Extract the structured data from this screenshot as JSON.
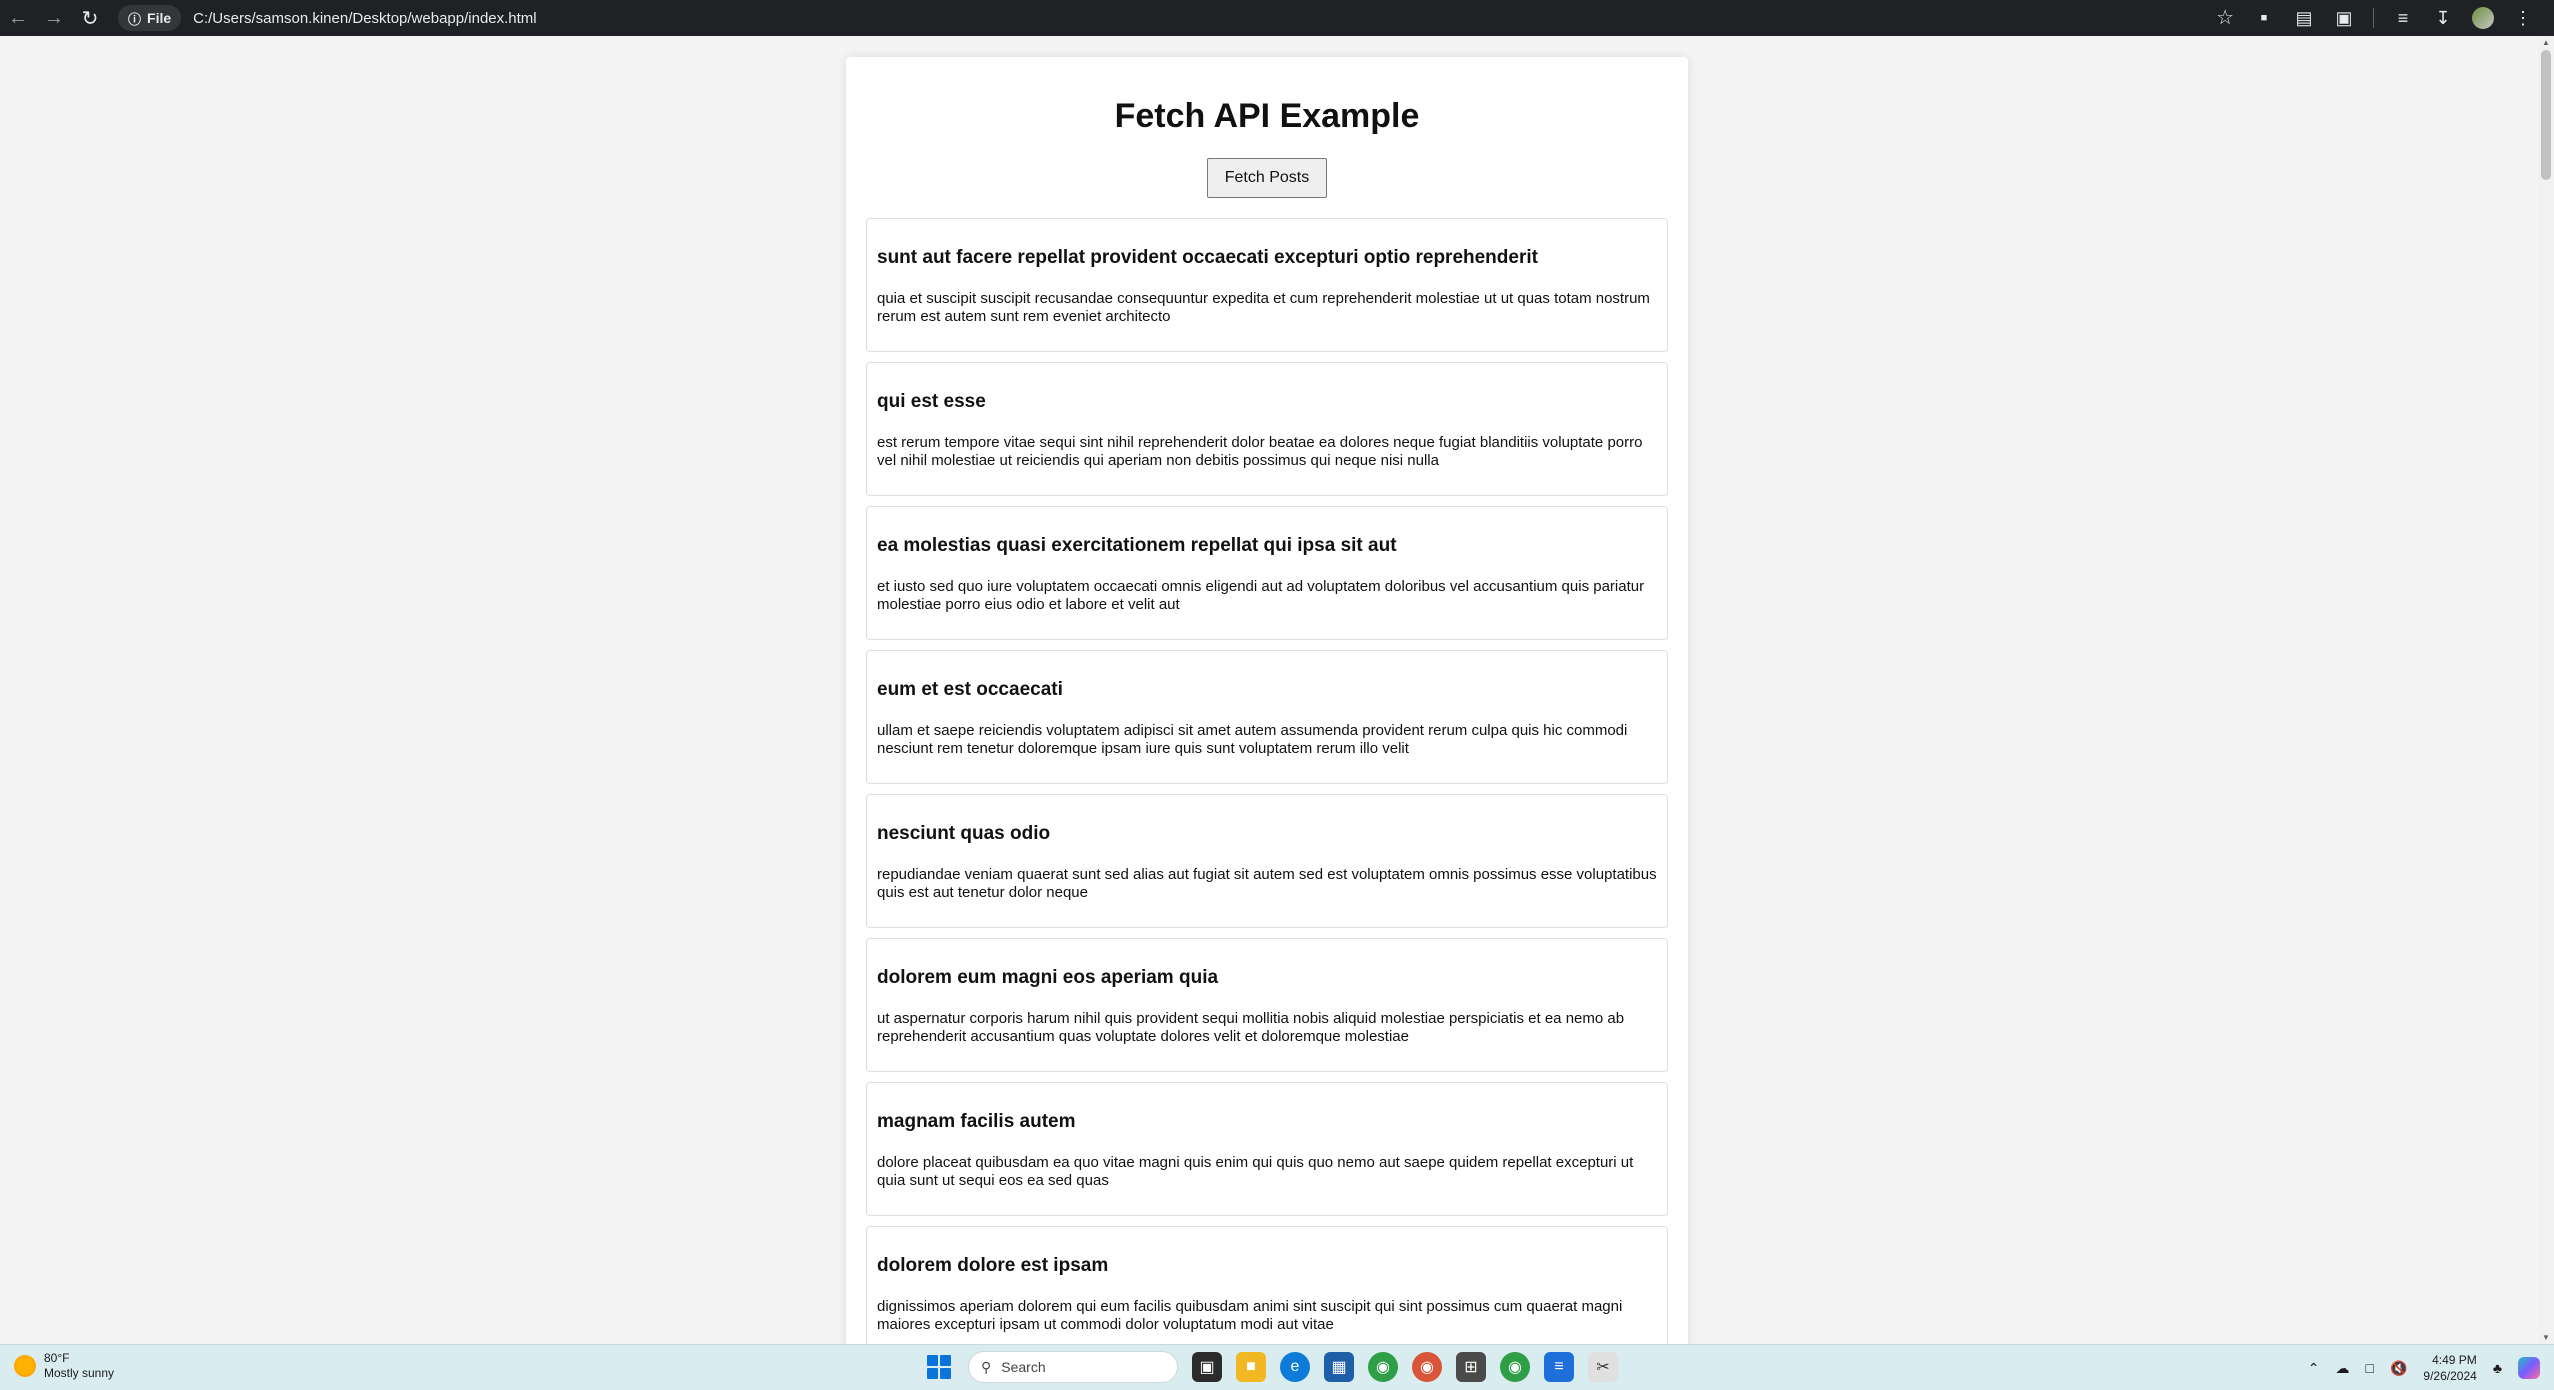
{
  "browser": {
    "back_icon": "back-arrow-icon",
    "forward_icon": "forward-arrow-icon",
    "reload_icon": "reload-icon",
    "site_chip_label": "File",
    "url": "C:/Users/samson.kinen/Desktop/webapp/index.html"
  },
  "page": {
    "title": "Fetch API Example",
    "fetch_button_label": "Fetch Posts",
    "posts": [
      {
        "title": "sunt aut facere repellat provident occaecati excepturi optio reprehenderit",
        "body": "quia et suscipit suscipit recusandae consequuntur expedita et cum reprehenderit molestiae ut ut quas totam nostrum rerum est autem sunt rem eveniet architecto"
      },
      {
        "title": "qui est esse",
        "body": "est rerum tempore vitae sequi sint nihil reprehenderit dolor beatae ea dolores neque fugiat blanditiis voluptate porro vel nihil molestiae ut reiciendis qui aperiam non debitis possimus qui neque nisi nulla"
      },
      {
        "title": "ea molestias quasi exercitationem repellat qui ipsa sit aut",
        "body": "et iusto sed quo iure voluptatem occaecati omnis eligendi aut ad voluptatem doloribus vel accusantium quis pariatur molestiae porro eius odio et labore et velit aut"
      },
      {
        "title": "eum et est occaecati",
        "body": "ullam et saepe reiciendis voluptatem adipisci sit amet autem assumenda provident rerum culpa quis hic commodi nesciunt rem tenetur doloremque ipsam iure quis sunt voluptatem rerum illo velit"
      },
      {
        "title": "nesciunt quas odio",
        "body": "repudiandae veniam quaerat sunt sed alias aut fugiat sit autem sed est voluptatem omnis possimus esse voluptatibus quis est aut tenetur dolor neque"
      },
      {
        "title": "dolorem eum magni eos aperiam quia",
        "body": "ut aspernatur corporis harum nihil quis provident sequi mollitia nobis aliquid molestiae perspiciatis et ea nemo ab reprehenderit accusantium quas voluptate dolores velit et doloremque molestiae"
      },
      {
        "title": "magnam facilis autem",
        "body": "dolore placeat quibusdam ea quo vitae magni quis enim qui quis quo nemo aut saepe quidem repellat excepturi ut quia sunt ut sequi eos ea sed quas"
      },
      {
        "title": "dolorem dolore est ipsam",
        "body": "dignissimos aperiam dolorem qui eum facilis quibusdam animi sint suscipit qui sint possimus cum quaerat magni maiores excepturi ipsam ut commodi dolor voluptatum modi aut vitae"
      }
    ]
  },
  "taskbar": {
    "weather_temp": "80°F",
    "weather_desc": "Mostly sunny",
    "search_placeholder": "Search",
    "time": "4:49 PM",
    "date": "9/26/2024"
  },
  "colors": {
    "accent_blue": "#0a74da",
    "page_bg": "#f4f4f4",
    "topbar_bg": "#202124"
  }
}
